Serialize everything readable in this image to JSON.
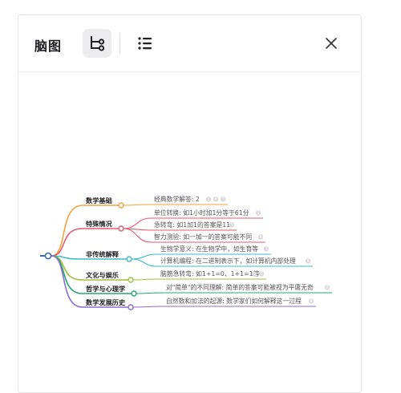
{
  "header": {
    "title": "脑图",
    "mindmap_view_icon": "mindmap-icon",
    "outline_view_icon": "list-icon",
    "close_icon": "close-icon"
  },
  "mindmap": {
    "categories": [
      {
        "label": "数学基础",
        "color": "#f2a33a",
        "items": [
          {
            "text": "经典数学解答: 2",
            "badges": [
              "1",
              "4",
              "7"
            ]
          }
        ]
      },
      {
        "label": "特殊情况",
        "color": "#e65a69",
        "items": [
          {
            "text": "单位转换: 如1小时加1分等于61分",
            "badges": [
              "2"
            ]
          },
          {
            "text": "急转弯: 如1加1的答案是11",
            "badges": [
              "5"
            ]
          },
          {
            "text": "智力测验: 如一加一的答案可能不同",
            "badges": [
              "8"
            ]
          }
        ]
      },
      {
        "label": "非传统解释",
        "color": "#3fbcc9",
        "items": [
          {
            "text": "生物学意义: 在生物学中，如生育等",
            "badges": [
              "3"
            ]
          },
          {
            "text": "计算机编程: 在二进制表示下，如计算机内部处理",
            "badges": [
              "9"
            ]
          }
        ]
      },
      {
        "label": "文化与娱乐",
        "color": "#9bc43f",
        "items": [
          {
            "text": "脑筋急转弯: 如1+1=0、1+1=1等",
            "badges": [
              "5",
              "6"
            ]
          }
        ]
      },
      {
        "label": "哲学与心理学",
        "color": "#25a86b",
        "items": [
          {
            "text": "对\"简单\"的不同理解: 简单的答案可能被视为平庸无奇",
            "badges": [
              "8"
            ]
          }
        ]
      },
      {
        "label": "数学发展历史",
        "color": "#8a6cd1",
        "items": [
          {
            "text": "自然数和加法的起源: 数学家们如何解释这一过程",
            "badges": [
              "8"
            ]
          }
        ]
      }
    ]
  }
}
